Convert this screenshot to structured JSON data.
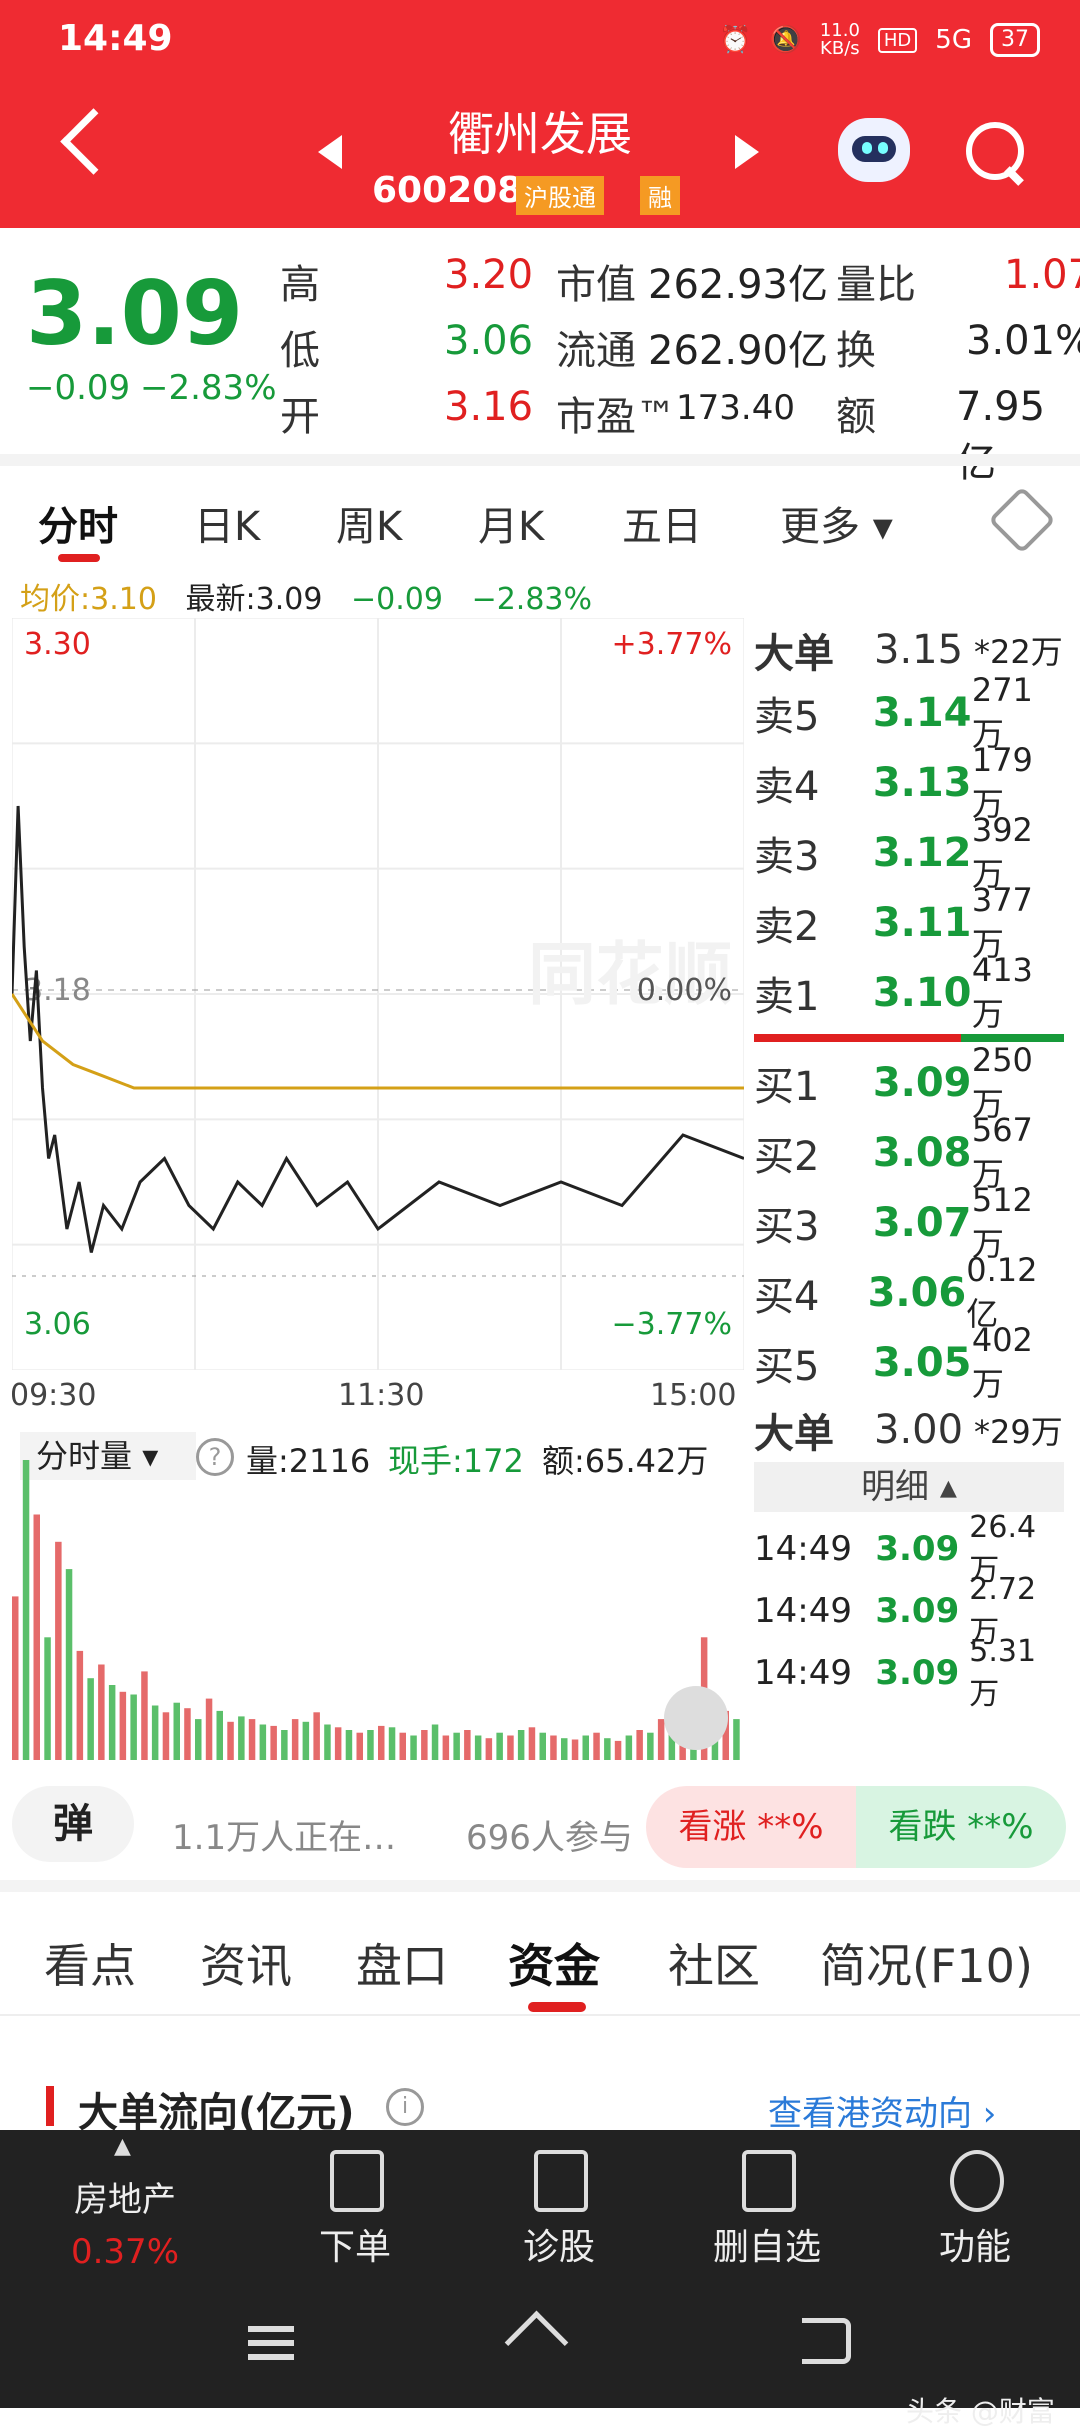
{
  "status": {
    "time": "14:49",
    "net": "11.0\nKB/s",
    "battery": "37",
    "signal": "5G"
  },
  "header": {
    "name": "衢州发展",
    "code": "600208",
    "tag1": "沪股通",
    "tag2": "融"
  },
  "quote": {
    "price": "3.09",
    "change": "−0.09",
    "change_pct": "−2.83%",
    "high_label": "高",
    "high": "3.20",
    "low_label": "低",
    "low": "3.06",
    "open_label": "开",
    "open": "3.16",
    "mcap_label": "市值",
    "mcap": "262.93亿",
    "float_label": "流通",
    "float": "262.90亿",
    "pe_label": "市盈™",
    "pe": "173.40",
    "vr_label": "量比",
    "vr": "1.07",
    "turn_label": "换",
    "turn": "3.01%",
    "amt_label": "额",
    "amt": "7.95亿"
  },
  "ktabs": [
    "分时",
    "日K",
    "周K",
    "月K",
    "五日",
    "更多"
  ],
  "avg_row": {
    "avg": "均价:3.10",
    "latest": "最新:3.09",
    "chg": "−0.09",
    "pct": "−2.83%"
  },
  "chart_data": {
    "type": "line",
    "title": "",
    "x_ticks": [
      "09:30",
      "11:30",
      "15:00"
    ],
    "ylim": [
      2.98,
      3.3
    ],
    "y_left_labels": {
      "top": "3.30",
      "mid": "3.18",
      "bottom": "3.06"
    },
    "y_right_labels": {
      "top": "+3.77%",
      "mid": "0.00%",
      "bottom": "−3.77%"
    },
    "series": [
      {
        "x": [
          0,
          2,
          4,
          6,
          8,
          10,
          12,
          14,
          18,
          22,
          26,
          30,
          36,
          42,
          50,
          58,
          66,
          74,
          82,
          90,
          100,
          110,
          120,
          140,
          160,
          180,
          200,
          220,
          240
        ],
        "y": [
          3.14,
          3.22,
          3.16,
          3.12,
          3.15,
          3.1,
          3.07,
          3.08,
          3.04,
          3.06,
          3.03,
          3.05,
          3.04,
          3.06,
          3.07,
          3.05,
          3.04,
          3.06,
          3.05,
          3.07,
          3.05,
          3.06,
          3.04,
          3.06,
          3.05,
          3.06,
          3.05,
          3.08,
          3.07
        ]
      },
      {
        "x": [
          0,
          10,
          20,
          30,
          40,
          60,
          80,
          120,
          160,
          200,
          240
        ],
        "y": [
          3.14,
          3.12,
          3.11,
          3.105,
          3.1,
          3.1,
          3.1,
          3.1,
          3.1,
          3.1,
          3.1
        ]
      }
    ],
    "volume_values": [
      120,
      220,
      180,
      90,
      160,
      140,
      80,
      60,
      70,
      55,
      50,
      48,
      65,
      40,
      35,
      42,
      38,
      30,
      45,
      36,
      28,
      32,
      30,
      26,
      25,
      22,
      30,
      28,
      35,
      26,
      24,
      22,
      20,
      22,
      25,
      24,
      20,
      18,
      22,
      26,
      18,
      20,
      22,
      18,
      16,
      20,
      18,
      22,
      24,
      20,
      18,
      16,
      15,
      18,
      20,
      16,
      14,
      18,
      22,
      20,
      30,
      28,
      26,
      24,
      90,
      40,
      36,
      30
    ],
    "volume_colors_red_every": 2
  },
  "vol_header": {
    "label": "分时量",
    "qty": "量:2116",
    "now": "现手:172",
    "amt": "额:65.42万"
  },
  "orderbook": {
    "big_sell": {
      "label": "大单",
      "price": "3.15",
      "vol": "*22万"
    },
    "asks": [
      {
        "label": "卖5",
        "price": "3.14",
        "vol": "271万"
      },
      {
        "label": "卖4",
        "price": "3.13",
        "vol": "179万"
      },
      {
        "label": "卖3",
        "price": "3.12",
        "vol": "392万"
      },
      {
        "label": "卖2",
        "price": "3.11",
        "vol": "377万"
      },
      {
        "label": "卖1",
        "price": "3.10",
        "vol": "413万"
      }
    ],
    "bids": [
      {
        "label": "买1",
        "price": "3.09",
        "vol": "250万"
      },
      {
        "label": "买2",
        "price": "3.08",
        "vol": "567万"
      },
      {
        "label": "买3",
        "price": "3.07",
        "vol": "512万"
      },
      {
        "label": "买4",
        "price": "3.06",
        "vol": "0.12亿"
      },
      {
        "label": "买5",
        "price": "3.05",
        "vol": "402万"
      }
    ],
    "big_buy": {
      "label": "大单",
      "price": "3.00",
      "vol": "*29万"
    },
    "detail_label": "明细",
    "ticks": [
      {
        "t": "14:49",
        "p": "3.09",
        "v": "26.4万"
      },
      {
        "t": "14:49",
        "p": "3.09",
        "v": "2.72万"
      },
      {
        "t": "14:49",
        "p": "3.09",
        "v": "5.31万"
      }
    ]
  },
  "promo": {
    "dan": "弹",
    "watchers": "1.1万人正在…",
    "participants": "696人参与",
    "up": "看涨 **%",
    "down": "看跌 **%"
  },
  "section_tabs": [
    "看点",
    "资讯",
    "盘口",
    "资金",
    "社区",
    "简况(F10)"
  ],
  "fund_flow": {
    "title": "大单流向(亿元)",
    "link": "查看港资动向"
  },
  "bottom": {
    "sector": "房地产",
    "sector_pct": "0.37%",
    "items": [
      "下单",
      "诊股",
      "删自选",
      "功能"
    ]
  },
  "watermark_brand": "头条 @财富"
}
